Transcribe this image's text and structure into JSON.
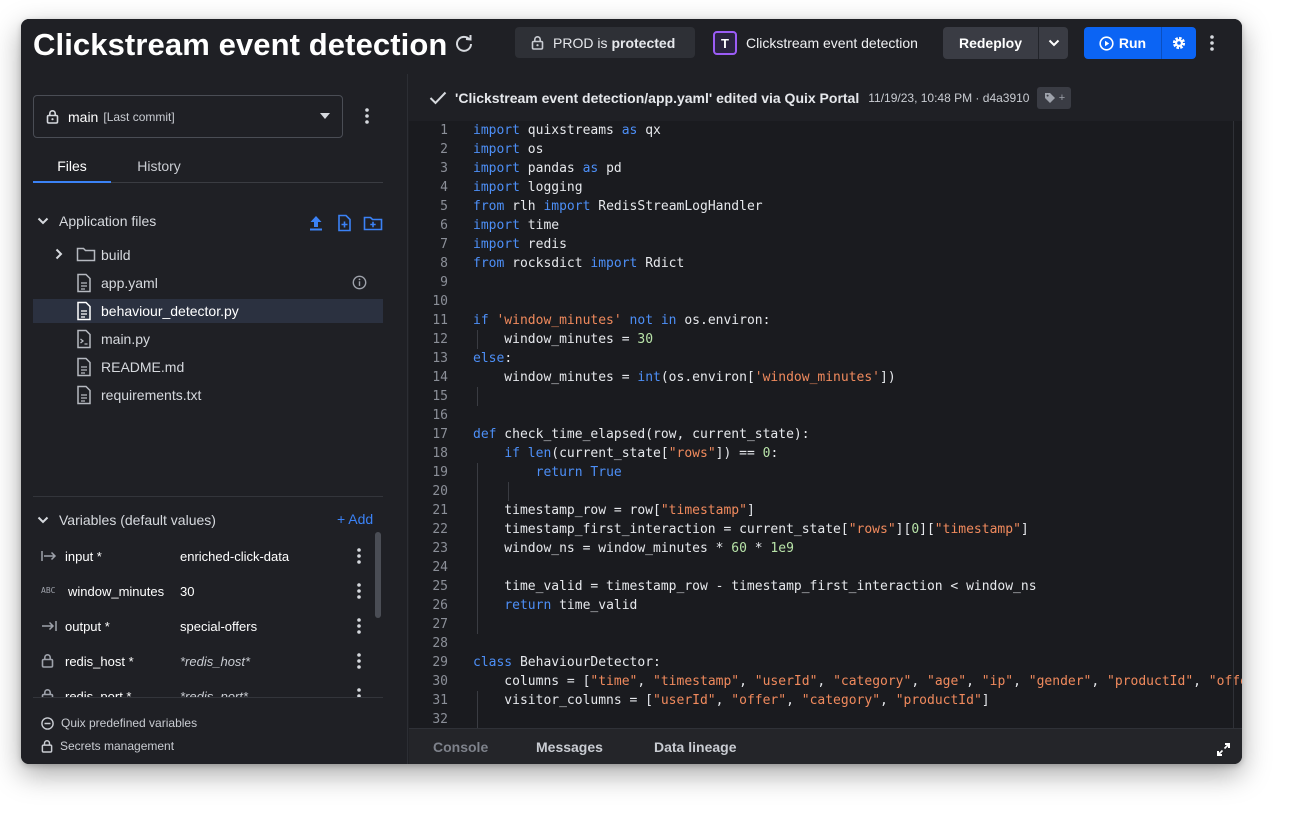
{
  "header": {
    "title": "Clickstream event detection",
    "environment": {
      "name": "PROD is",
      "state": "protected"
    },
    "project": {
      "initial": "T",
      "name": "Clickstream event detection"
    },
    "redeploy_label": "Redeploy",
    "run_label": "Run"
  },
  "sidebar": {
    "branch": {
      "name": "main",
      "note": "[Last commit]"
    },
    "tabs": [
      {
        "label": "Files",
        "active": true
      },
      {
        "label": "History",
        "active": false
      }
    ],
    "app_files_label": "Application files",
    "files": [
      {
        "name": "build",
        "type": "folder",
        "icon": "folder-icon"
      },
      {
        "name": "app.yaml",
        "type": "file",
        "icon": "file-icon"
      },
      {
        "name": "behaviour_detector.py",
        "type": "file",
        "icon": "file-icon",
        "selected": true
      },
      {
        "name": "main.py",
        "type": "file",
        "icon": "python-file-icon"
      },
      {
        "name": "README.md",
        "type": "file",
        "icon": "file-icon"
      },
      {
        "name": "requirements.txt",
        "type": "file",
        "icon": "file-icon"
      }
    ],
    "variables_label": "Variables (default values)",
    "add_label": "+ Add",
    "variables": [
      {
        "name": "input *",
        "value": "enriched-click-data",
        "icon": "input-arrow-icon"
      },
      {
        "name": "window_minutes",
        "value": "30",
        "icon": "abc-icon"
      },
      {
        "name": "output *",
        "value": "special-offers",
        "icon": "output-arrow-icon"
      },
      {
        "name": "redis_host *",
        "value": "*redis_host*",
        "icon": "lock-icon",
        "secret": true
      },
      {
        "name": "redis_port *",
        "value": "*redis_port*",
        "icon": "lock-icon",
        "secret": true
      }
    ],
    "abc_glyph": "ABC",
    "predefined_vars_label": "Quix predefined variables",
    "secrets_label": "Secrets management"
  },
  "editor": {
    "commit_message": "'Clickstream event detection/app.yaml' edited via Quix Portal",
    "commit_meta": "11/19/23, 10:48 PM · d4a3910",
    "tag_plus": "+",
    "code_lines": [
      [
        [
          "kw",
          "import"
        ],
        [
          "t",
          " quixstreams "
        ],
        [
          "kw",
          "as"
        ],
        [
          "t",
          " qx"
        ]
      ],
      [
        [
          "kw",
          "import"
        ],
        [
          "t",
          " os"
        ]
      ],
      [
        [
          "kw",
          "import"
        ],
        [
          "t",
          " pandas "
        ],
        [
          "kw",
          "as"
        ],
        [
          "t",
          " pd"
        ]
      ],
      [
        [
          "kw",
          "import"
        ],
        [
          "t",
          " logging"
        ]
      ],
      [
        [
          "kw",
          "from"
        ],
        [
          "t",
          " rlh "
        ],
        [
          "kw",
          "import"
        ],
        [
          "t",
          " RedisStreamLogHandler"
        ]
      ],
      [
        [
          "kw",
          "import"
        ],
        [
          "t",
          " time"
        ]
      ],
      [
        [
          "kw",
          "import"
        ],
        [
          "t",
          " redis"
        ]
      ],
      [
        [
          "kw",
          "from"
        ],
        [
          "t",
          " rocksdict "
        ],
        [
          "kw",
          "import"
        ],
        [
          "t",
          " Rdict"
        ]
      ],
      [],
      [],
      [
        [
          "kw",
          "if"
        ],
        [
          "t",
          " "
        ],
        [
          "str",
          "'window_minutes'"
        ],
        [
          "t",
          " "
        ],
        [
          "kw",
          "not"
        ],
        [
          "t",
          " "
        ],
        [
          "kw",
          "in"
        ],
        [
          "t",
          " os.environ:"
        ]
      ],
      [
        [
          "t",
          "    window_minutes = "
        ],
        [
          "num",
          "30"
        ]
      ],
      [
        [
          "kw",
          "else"
        ],
        [
          "t",
          ":"
        ]
      ],
      [
        [
          "t",
          "    window_minutes = "
        ],
        [
          "kw",
          "int"
        ],
        [
          "t",
          "(os.environ["
        ],
        [
          "str",
          "'window_minutes'"
        ],
        [
          "t",
          "])"
        ]
      ],
      [],
      [],
      [
        [
          "kw",
          "def"
        ],
        [
          "t",
          " check_time_elapsed(row, current_state):"
        ]
      ],
      [
        [
          "t",
          "    "
        ],
        [
          "kw",
          "if"
        ],
        [
          "t",
          " "
        ],
        [
          "kw",
          "len"
        ],
        [
          "t",
          "(current_state["
        ],
        [
          "str",
          "\"rows\""
        ],
        [
          "t",
          "]) == "
        ],
        [
          "num",
          "0"
        ],
        [
          "t",
          ":"
        ]
      ],
      [
        [
          "t",
          "        "
        ],
        [
          "kw",
          "return"
        ],
        [
          "t",
          " "
        ],
        [
          "kw",
          "True"
        ]
      ],
      [],
      [
        [
          "t",
          "    timestamp_row = row["
        ],
        [
          "str",
          "\"timestamp\""
        ],
        [
          "t",
          "]"
        ]
      ],
      [
        [
          "t",
          "    timestamp_first_interaction = current_state["
        ],
        [
          "str",
          "\"rows\""
        ],
        [
          "t",
          "]["
        ],
        [
          "num",
          "0"
        ],
        [
          "t",
          "]["
        ],
        [
          "str",
          "\"timestamp\""
        ],
        [
          "t",
          "]"
        ]
      ],
      [
        [
          "t",
          "    window_ns = window_minutes * "
        ],
        [
          "num",
          "60"
        ],
        [
          "t",
          " * "
        ],
        [
          "num",
          "1e9"
        ]
      ],
      [],
      [
        [
          "t",
          "    time_valid = timestamp_row - timestamp_first_interaction < window_ns"
        ]
      ],
      [
        [
          "t",
          "    "
        ],
        [
          "kw",
          "return"
        ],
        [
          "t",
          " time_valid"
        ]
      ],
      [],
      [],
      [
        [
          "kw",
          "class"
        ],
        [
          "t",
          " BehaviourDetector:"
        ]
      ],
      [
        [
          "t",
          "    columns = ["
        ],
        [
          "str",
          "\"time\""
        ],
        [
          "t",
          ", "
        ],
        [
          "str",
          "\"timestamp\""
        ],
        [
          "t",
          ", "
        ],
        [
          "str",
          "\"userId\""
        ],
        [
          "t",
          ", "
        ],
        [
          "str",
          "\"category\""
        ],
        [
          "t",
          ", "
        ],
        [
          "str",
          "\"age\""
        ],
        [
          "t",
          ", "
        ],
        [
          "str",
          "\"ip\""
        ],
        [
          "t",
          ", "
        ],
        [
          "str",
          "\"gender\""
        ],
        [
          "t",
          ", "
        ],
        [
          "str",
          "\"productId\""
        ],
        [
          "t",
          ", "
        ],
        [
          "str",
          "\"offer"
        ]
      ],
      [
        [
          "t",
          "    visitor_columns = ["
        ],
        [
          "str",
          "\"userId\""
        ],
        [
          "t",
          ", "
        ],
        [
          "str",
          "\"offer\""
        ],
        [
          "t",
          ", "
        ],
        [
          "str",
          "\"category\""
        ],
        [
          "t",
          ", "
        ],
        [
          "str",
          "\"productId\""
        ],
        [
          "t",
          "]"
        ]
      ],
      []
    ]
  },
  "bottom_tabs": [
    "Console",
    "Messages",
    "Data lineage"
  ],
  "colors": {
    "accent": "#0b64f4",
    "keyword": "#4d8ff7",
    "string": "#f08a5d",
    "number": "#b8e3a8",
    "project_border": "#9b5cf6"
  }
}
